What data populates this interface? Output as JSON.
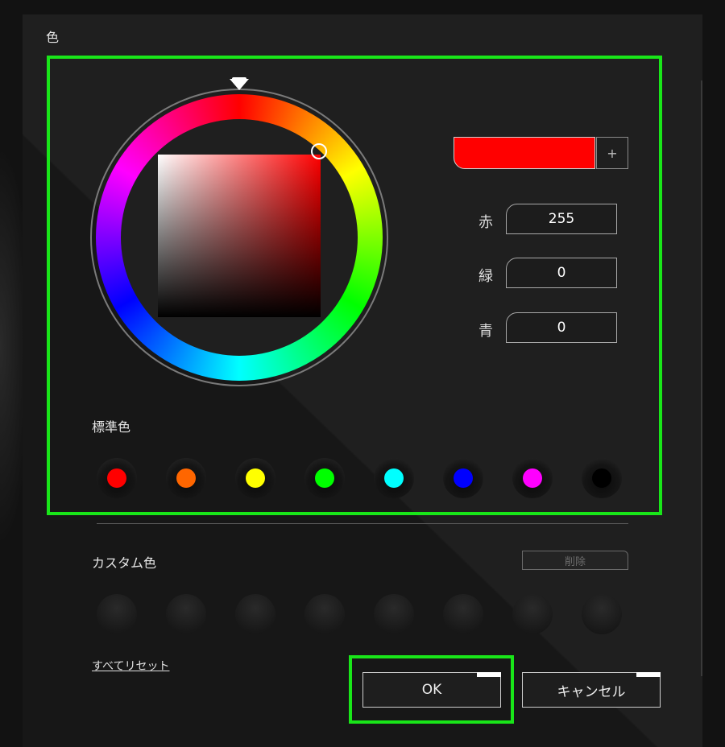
{
  "dialog": {
    "title": "色"
  },
  "current_color": {
    "hex": "#ff0000"
  },
  "add_button": {
    "label": "+"
  },
  "rgb": {
    "red": {
      "label": "赤",
      "value": "255"
    },
    "green": {
      "label": "緑",
      "value": "0"
    },
    "blue": {
      "label": "青",
      "value": "0"
    }
  },
  "standard_colors": {
    "label": "標準色",
    "items": [
      {
        "name": "red",
        "hex": "#ff0000"
      },
      {
        "name": "orange",
        "hex": "#ff6600"
      },
      {
        "name": "yellow",
        "hex": "#ffff00"
      },
      {
        "name": "green",
        "hex": "#00ff00"
      },
      {
        "name": "cyan",
        "hex": "#00ffff"
      },
      {
        "name": "blue",
        "hex": "#0000ff"
      },
      {
        "name": "magenta",
        "hex": "#ff00ff"
      },
      {
        "name": "black",
        "hex": "#000000"
      }
    ]
  },
  "custom_colors": {
    "label": "カスタム色",
    "delete_label": "削除",
    "slots": 8
  },
  "reset_label": "すべてリセット",
  "buttons": {
    "ok": "OK",
    "cancel": "キャンセル"
  },
  "highlight_color": "#19e619"
}
